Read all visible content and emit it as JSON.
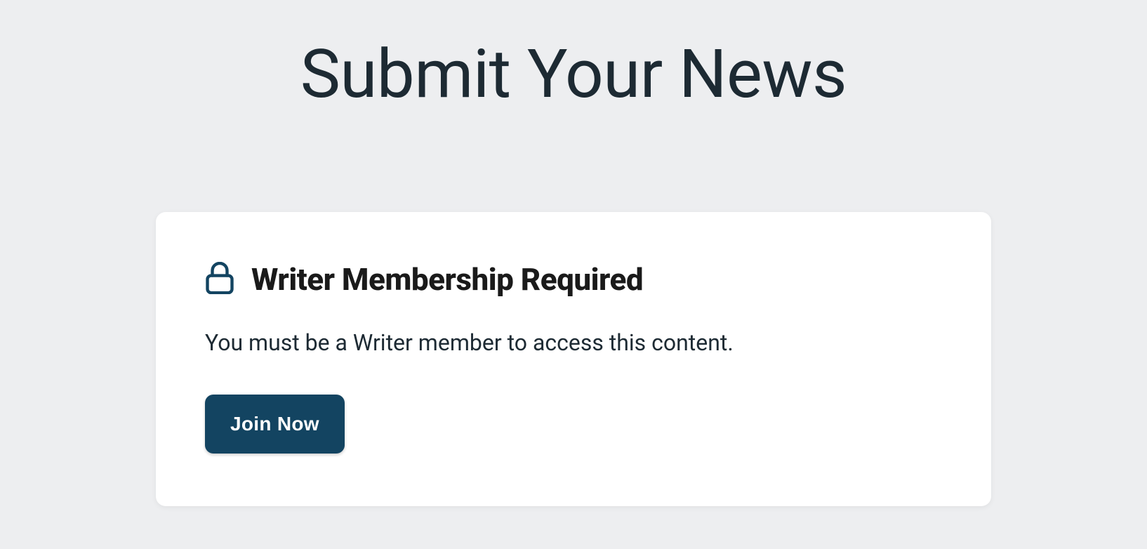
{
  "page": {
    "title": "Submit Your News"
  },
  "card": {
    "title": "Writer Membership Required",
    "description": "You must be a Writer member to access this content.",
    "button_label": "Join Now"
  }
}
